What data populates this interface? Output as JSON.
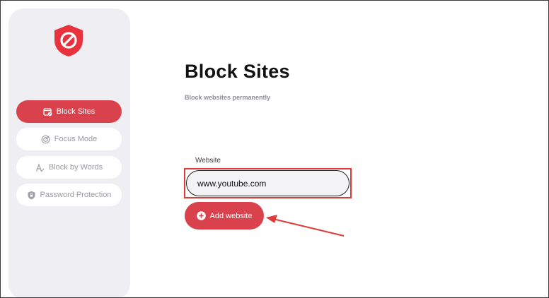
{
  "sidebar": {
    "logo_icon": "shield-block-icon",
    "items": [
      {
        "label": "Block Sites",
        "icon": "calendar-block-icon",
        "active": true
      },
      {
        "label": "Focus Mode",
        "icon": "target-icon",
        "active": false
      },
      {
        "label": "Block by Words",
        "icon": "font-pen-icon",
        "active": false
      },
      {
        "label": "Password Protection",
        "icon": "shield-lock-icon",
        "active": false
      }
    ]
  },
  "main": {
    "title": "Block Sites",
    "subtitle": "Block websites permanently",
    "website_label": "Website",
    "website_value": "www.youtube.com",
    "add_button_label": "Add website"
  },
  "colors": {
    "accent": "#d9424c",
    "sidebar_bg": "#efeff3",
    "annotation": "#e03a3a"
  }
}
